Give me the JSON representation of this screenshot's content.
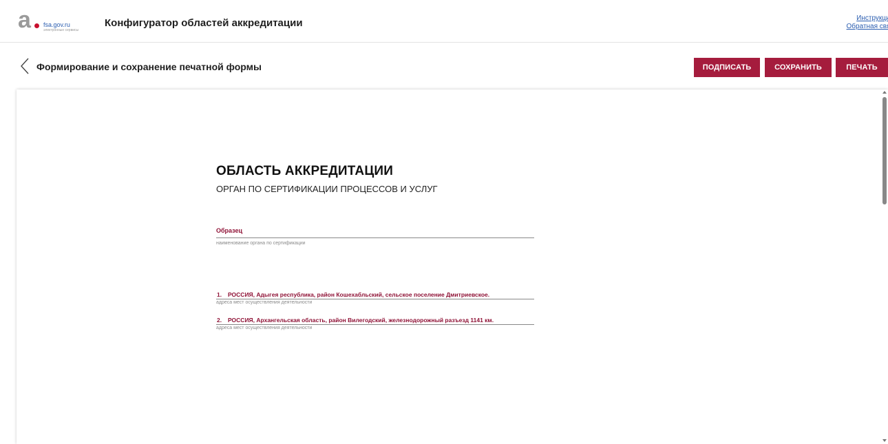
{
  "header": {
    "logo_site": "fsa.gov.ru",
    "logo_sub": "электронные сервисы",
    "app_title": "Конфигуратор областей аккредитации",
    "links": {
      "instruction": "Инструкция",
      "feedback": "Обратная связ"
    }
  },
  "toolbar": {
    "page_title": "Формирование и сохранение печатной формы",
    "sign_label": "ПОДПИСАТЬ",
    "save_label": "СОХРАНИТЬ",
    "print_label": "ПЕЧАТЬ"
  },
  "document": {
    "heading": "ОБЛАСТЬ АККРЕДИТАЦИИ",
    "subheading": "ОРГАН ПО СЕРТИФИКАЦИИ ПРОЦЕССОВ И УСЛУГ",
    "org_name": "Образец",
    "org_caption": "наименование органа по сертификации",
    "addresses": [
      {
        "num": "1.",
        "text": "РОССИЯ, Адыгея республика, район Кошехабльский, сельское поселение Дмитриевское.",
        "caption": "адреса мест осуществления деятельности"
      },
      {
        "num": "2.",
        "text": "РОССИЯ, Архангельская область, район Вилегодский, железнодорожный разъезд 1141 км.",
        "caption": "адреса мест осуществления деятельности"
      }
    ]
  },
  "colors": {
    "accent": "#a51c3d",
    "doc_text_accent": "#8f1236",
    "link": "#2a5db0"
  },
  "icons": {
    "back": "chevron-left-icon",
    "logo": "fsa-logo"
  }
}
